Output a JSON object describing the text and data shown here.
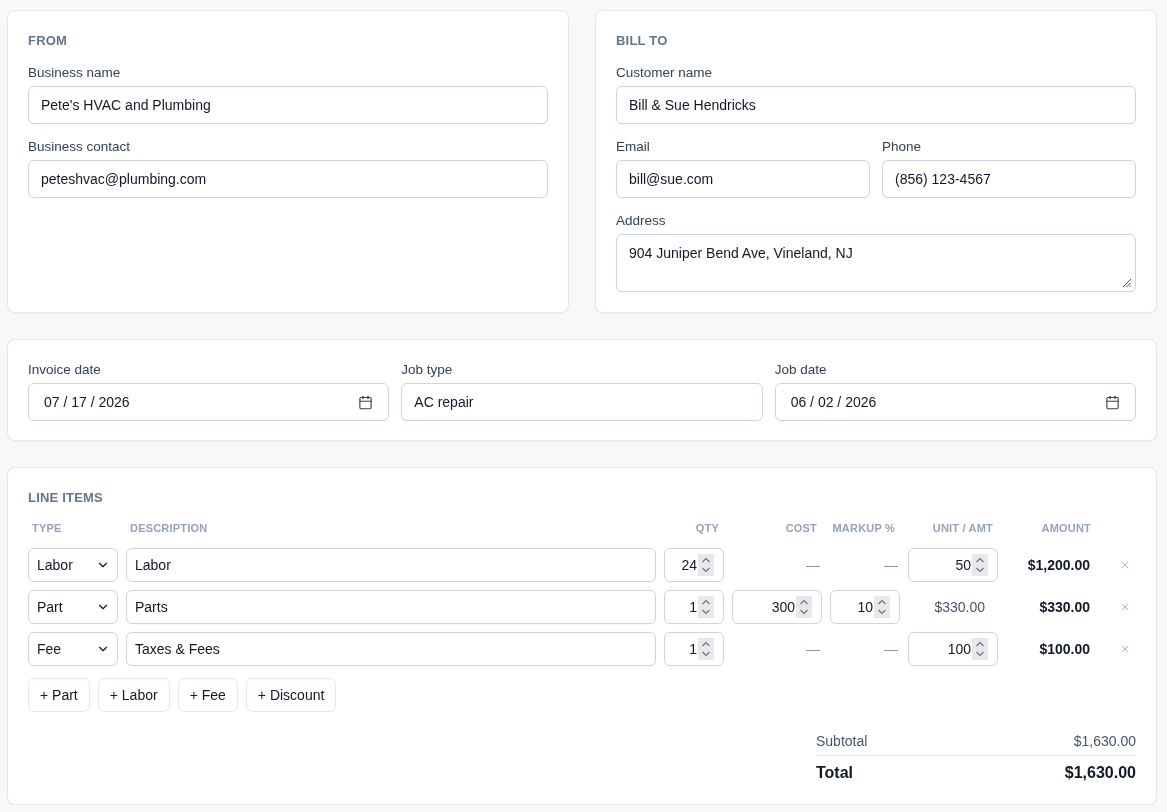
{
  "from": {
    "heading": "FROM",
    "fields": [
      {
        "label": "Business name",
        "value": "Pete's HVAC and Plumbing"
      },
      {
        "label": "Business contact",
        "value": "peteshvac@plumbing.com"
      }
    ]
  },
  "bill_to": {
    "heading": "BILL TO",
    "customer_name": {
      "label": "Customer name",
      "value": "Bill & Sue Hendricks"
    },
    "email": {
      "label": "Email",
      "value": "bill@sue.com"
    },
    "phone": {
      "label": "Phone",
      "value": "(856) 123-4567"
    },
    "address": {
      "label": "Address",
      "value": "904 Juniper Bend Ave, Vineland, NJ"
    }
  },
  "job": {
    "fields": [
      {
        "kind": "date",
        "label": "Invoice date",
        "value": "07 / 17 / 2026"
      },
      {
        "kind": "text",
        "label": "Job type",
        "value": "AC repair"
      },
      {
        "kind": "date",
        "label": "Job date",
        "value": "06 / 02 / 2026"
      }
    ]
  },
  "line_items": {
    "heading": "LINE ITEMS",
    "columns": [
      "TYPE",
      "DESCRIPTION",
      "QTY",
      "COST",
      "MARKUP %",
      "UNIT / AMT",
      "AMOUNT"
    ],
    "rows": [
      {
        "type": "Labor",
        "description": "Labor",
        "qty": "24",
        "cost": {
          "kind": "blank",
          "value": "—"
        },
        "markup": {
          "kind": "blank",
          "value": "—"
        },
        "unit": {
          "kind": "input",
          "value": "50"
        },
        "amount": "$1,200.00"
      },
      {
        "type": "Part",
        "description": "Parts",
        "qty": "1",
        "cost": {
          "kind": "input",
          "value": "300"
        },
        "markup": {
          "kind": "input",
          "value": "10"
        },
        "unit": {
          "kind": "computed",
          "value": "$330.00"
        },
        "amount": "$330.00"
      },
      {
        "type": "Fee",
        "description": "Taxes & Fees",
        "qty": "1",
        "cost": {
          "kind": "blank",
          "value": "—"
        },
        "markup": {
          "kind": "blank",
          "value": "—"
        },
        "unit": {
          "kind": "input",
          "value": "100"
        },
        "amount": "$100.00"
      }
    ],
    "add_buttons": [
      "+ Part",
      "+ Labor",
      "+ Fee",
      "+ Discount"
    ]
  },
  "totals": {
    "subtotal": {
      "label": "Subtotal",
      "value": "$1,630.00"
    },
    "total": {
      "label": "Total",
      "value": "$1,630.00"
    }
  }
}
